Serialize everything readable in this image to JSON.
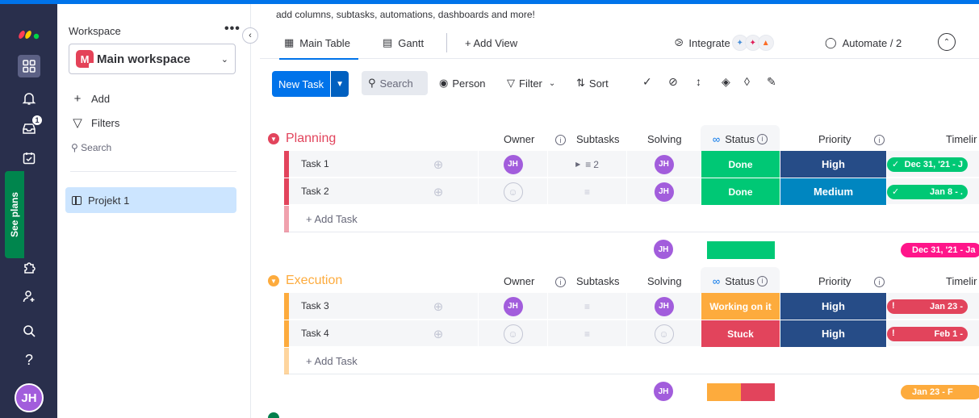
{
  "colors": {
    "accent": "#0073ea",
    "rail": "#292f4c",
    "done": "#00c875",
    "working": "#fdab3d",
    "stuck": "#e2445c",
    "high": "#264c87",
    "medium": "#0086c0",
    "planning": "#e2445c",
    "execution": "#fdab3d",
    "avatar": "#a25ddc",
    "timeline_done": "#00c875",
    "timeline_pink": "#ff158a",
    "timeline_red": "#e2445c",
    "timeline_orange": "#fdab3d"
  },
  "rail": {
    "notification_count": "1",
    "see_plans": "See plans",
    "user_initials": "JH",
    "help": "?"
  },
  "workspace": {
    "label": "Workspace",
    "more": "•••",
    "icon_letter": "M",
    "name": "Main workspace",
    "add": "Add",
    "filters": "Filters",
    "search": "Search",
    "items": [
      {
        "label": "Projekt 1"
      }
    ]
  },
  "main": {
    "banner": "add columns, subtasks, automations, dashboards and more!",
    "views": {
      "main_table": "Main Table",
      "gantt": "Gantt",
      "add_view": "+ Add View",
      "integrate": "Integrate",
      "automate": "Automate / 2"
    },
    "toolbar": {
      "new_task": "New Task",
      "search": "Search",
      "person": "Person",
      "filter": "Filter",
      "sort": "Sort"
    },
    "columns": {
      "owner": "Owner",
      "subtasks": "Subtasks",
      "solving": "Solving",
      "status": "Status",
      "priority": "Priority",
      "timeline": "Timelir"
    },
    "add_task": "+ Add Task",
    "groups": [
      {
        "title": "Planning",
        "tasks": [
          {
            "name": "Task 1",
            "owner": "JH",
            "subtasks": "2",
            "solving": "JH",
            "status": "Done",
            "priority": "High",
            "timeline": "Dec 31, '21 - J"
          },
          {
            "name": "Task 2",
            "owner": "",
            "subtasks": "",
            "solving": "JH",
            "status": "Done",
            "priority": "Medium",
            "timeline": "Jan 8 - ."
          }
        ],
        "summary_avatar": "JH",
        "summary_timeline": "Dec 31, '21 - Ja"
      },
      {
        "title": "Execution",
        "tasks": [
          {
            "name": "Task 3",
            "owner": "JH",
            "subtasks": "",
            "solving": "JH",
            "status": "Working on it",
            "priority": "High",
            "timeline": "Jan 23 -"
          },
          {
            "name": "Task 4",
            "owner": "",
            "subtasks": "",
            "solving": "",
            "status": "Stuck",
            "priority": "High",
            "timeline": "Feb 1 -"
          }
        ],
        "summary_avatar": "JH",
        "summary_timeline": "Jan 23 - F"
      }
    ]
  }
}
